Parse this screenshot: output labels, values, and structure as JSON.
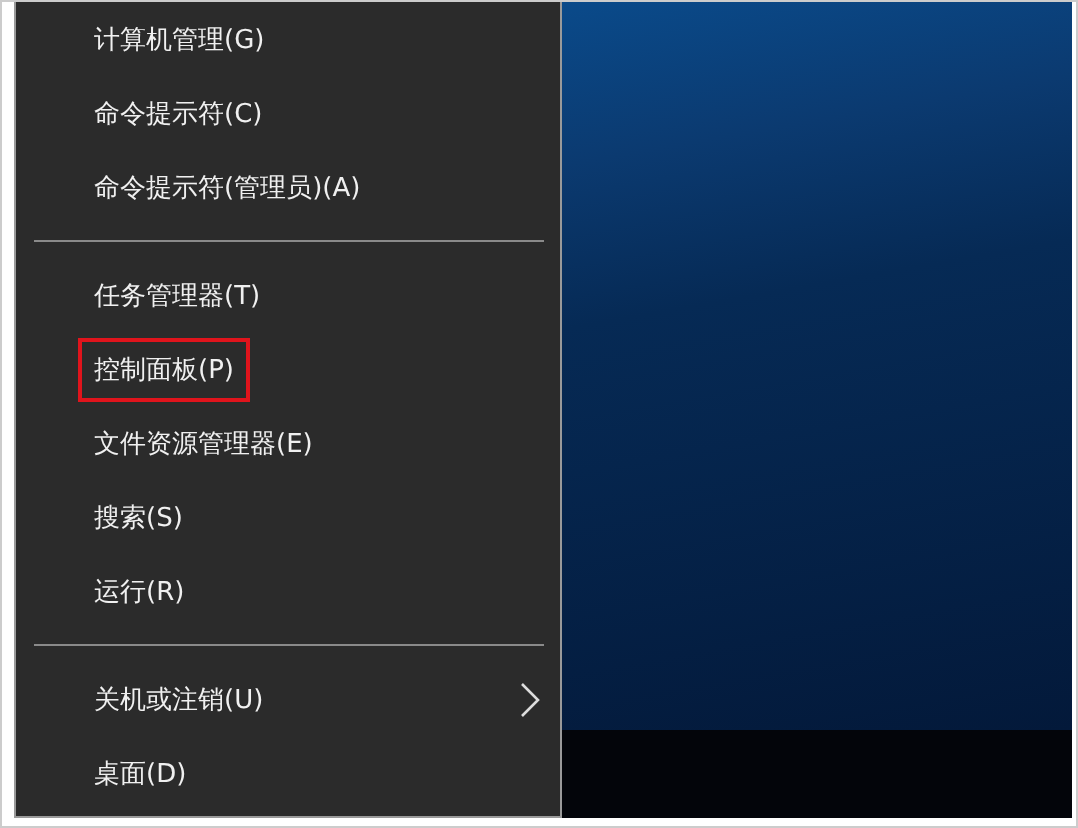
{
  "menu": {
    "groups": [
      {
        "items": [
          {
            "label": "计算机管理(G)",
            "highlighted": false,
            "submenu": false
          },
          {
            "label": "命令提示符(C)",
            "highlighted": false,
            "submenu": false
          },
          {
            "label": "命令提示符(管理员)(A)",
            "highlighted": false,
            "submenu": false
          }
        ]
      },
      {
        "items": [
          {
            "label": "任务管理器(T)",
            "highlighted": false,
            "submenu": false
          },
          {
            "label": "控制面板(P)",
            "highlighted": true,
            "submenu": false
          },
          {
            "label": "文件资源管理器(E)",
            "highlighted": false,
            "submenu": false
          },
          {
            "label": "搜索(S)",
            "highlighted": false,
            "submenu": false
          },
          {
            "label": "运行(R)",
            "highlighted": false,
            "submenu": false
          }
        ]
      },
      {
        "items": [
          {
            "label": "关机或注销(U)",
            "highlighted": false,
            "submenu": true
          },
          {
            "label": "桌面(D)",
            "highlighted": false,
            "submenu": false
          }
        ]
      }
    ]
  }
}
